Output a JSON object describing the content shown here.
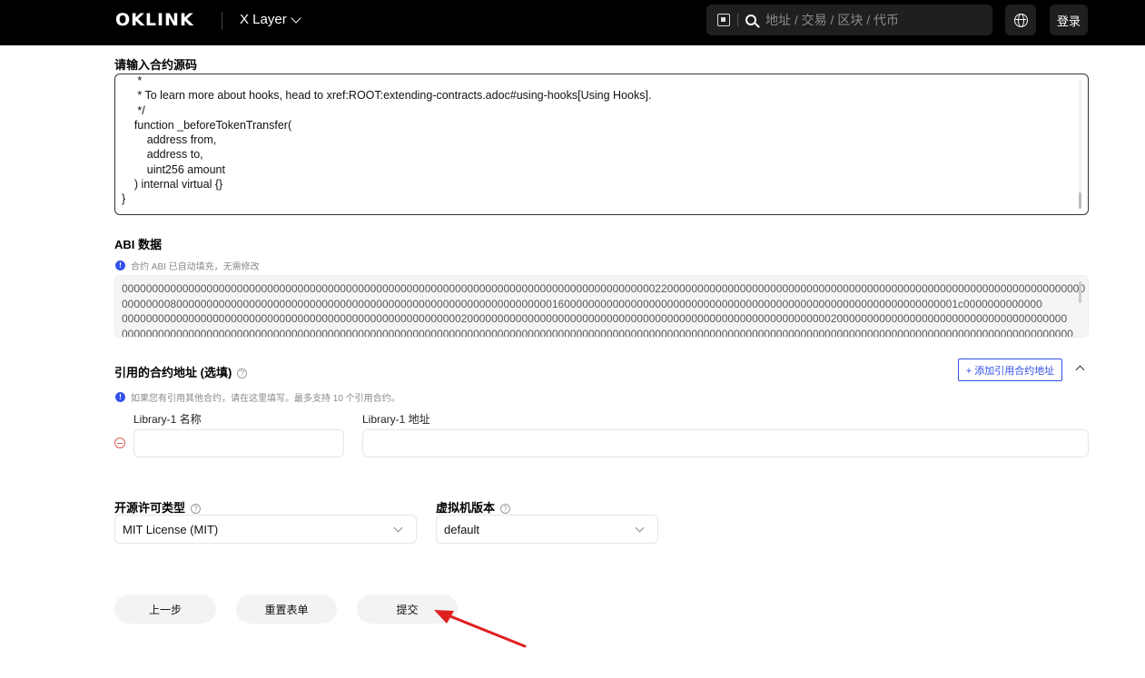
{
  "header": {
    "logo": "OKLINK",
    "chain": "X Layer",
    "search_placeholder": "地址 / 交易 / 区块 / 代币",
    "login": "登录"
  },
  "source_code": {
    "label": "请输入合约源码",
    "lines": [
      "     *",
      "     * To learn more about hooks, head to xref:ROOT:extending-contracts.adoc#using-hooks[Using Hooks].",
      "     */",
      "    function _beforeTokenTransfer(",
      "        address from,",
      "        address to,",
      "        uint256 amount",
      "    ) internal virtual {}",
      "}"
    ]
  },
  "abi": {
    "label": "ABI 数据",
    "hint": "合约 ABI 已自动填充，无需修改",
    "lines": [
      "000000000000000000000000000000000000000000000000000000000000000000000000000000000000000022000000000000000000000000000000000000000000000000000000000000000000000",
      "000000008000000000000000000000000000000000000000000000000000000000000001600000000000000000000000000000000000000000000000000000000000000001c0000000000000",
      "000000000000000000000000000000000000000000000000000000002000000000000000000000000000000000000000000000000000000000000200000000000000000000000000000000000000",
      "0000000000000000000000000000000000000000000000000000000000000000000000000000000000000000000000000000000000000000000000000000000000000000000000000000000000000"
    ]
  },
  "libraries": {
    "label": "引用的合约地址 (选填)",
    "hint": "如果您有引用其他合约，请在这里填写。最多支持 10 个引用合约。",
    "add_button": "+ 添加引用合约地址",
    "name_label": "Library-1 名称",
    "address_label": "Library-1 地址",
    "name_value": "",
    "address_value": ""
  },
  "license": {
    "label": "开源许可类型",
    "value": "MIT License (MIT)"
  },
  "vm": {
    "label": "虚拟机版本",
    "value": "default"
  },
  "actions": {
    "prev": "上一步",
    "reset": "重置表单",
    "submit": "提交"
  },
  "colors": {
    "accent": "#3451e8",
    "annotation_arrow": "#e02020"
  }
}
